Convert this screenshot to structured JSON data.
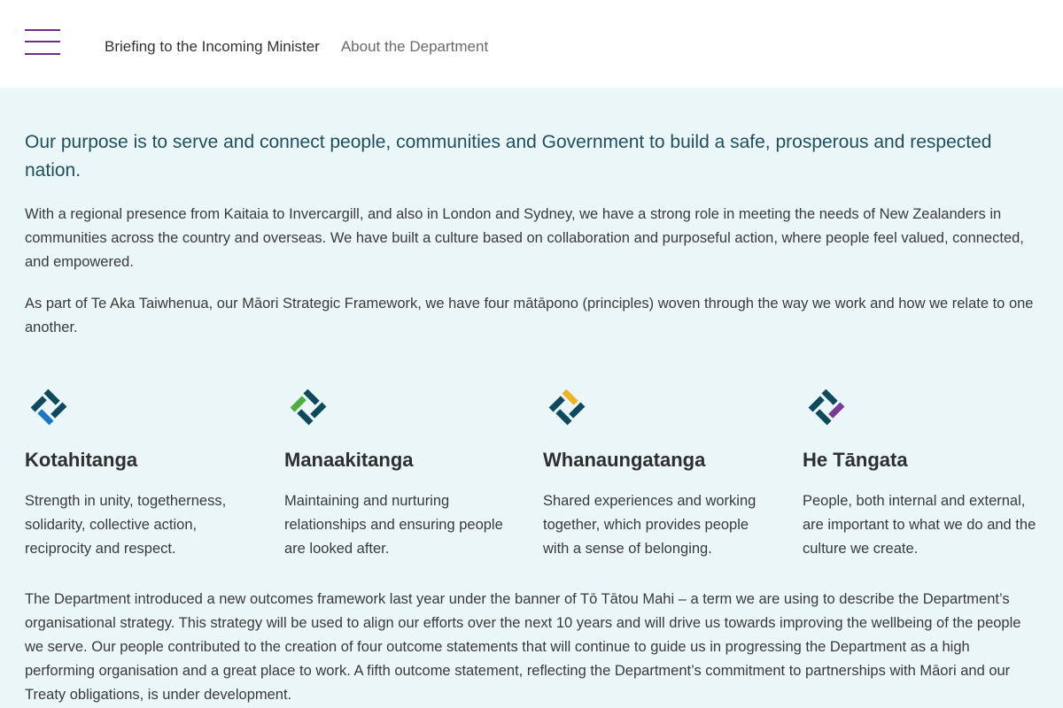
{
  "header": {
    "menu_icon": "hamburger-menu-icon",
    "nav": [
      {
        "label": "Briefing to the Incoming Minister"
      },
      {
        "label": "About the Department"
      }
    ]
  },
  "main": {
    "lead": "Our purpose is to serve and connect people, communities and Government to build a safe, prosperous and respected nation.",
    "paragraph_1": "With a regional presence from Kaitaia to Invercargill, and also in London and Sydney, we have a strong role in meeting the needs of New Zealanders in communities across the country and overseas. We have built a culture based on collaboration and purposeful action, where people feel valued, connected, and empowered.",
    "paragraph_2": "As part of Te Aka Taiwhenua, our Māori Strategic Framework, we have four mātāpono (principles) woven through the way we work and how we relate to one another.",
    "principles": [
      {
        "name": "Kotahitanga",
        "description": "Strength in unity, togetherness, solidarity, collective action, reciprocity and respect.",
        "accent": "#1f77c4",
        "icon": "kotahitanga-emblem-icon"
      },
      {
        "name": "Manaakitanga",
        "description": "Maintaining and nurturing relationships and ensuring people are looked after.",
        "accent": "#4cae3c",
        "icon": "manaakitanga-emblem-icon"
      },
      {
        "name": "Whanaungatanga",
        "description": "Shared experiences and working together, which provides people with a sense of belonging.",
        "accent": "#f0b323",
        "icon": "whanaungatanga-emblem-icon"
      },
      {
        "name": "He Tāngata",
        "description": "People, both internal and external, are important to what we do and the culture we create.",
        "accent": "#7b3a96",
        "icon": "he-tangata-emblem-icon"
      }
    ],
    "paragraph_3": "The Department introduced a new outcomes framework last year under the banner of Tō Tātou Mahi – a term we are using to describe the Department’s organisational strategy. This strategy will be used to align our efforts over the next 10 years and will drive us towards improving the wellbeing of the people we serve. Our people contributed to the creation of four outcome statements that will continue to guide us in progressing the Department as a high performing organisation and a great place to work. A fifth outcome statement, reflecting the Department’s commitment to partnerships with Māori and our Treaty obligations, is under development."
  },
  "colors": {
    "brand_purple": "#6b2f86",
    "emblem_dark": "#0e4a5c",
    "content_background": "#eaf6f7",
    "lead_text": "#1f4f5f"
  }
}
